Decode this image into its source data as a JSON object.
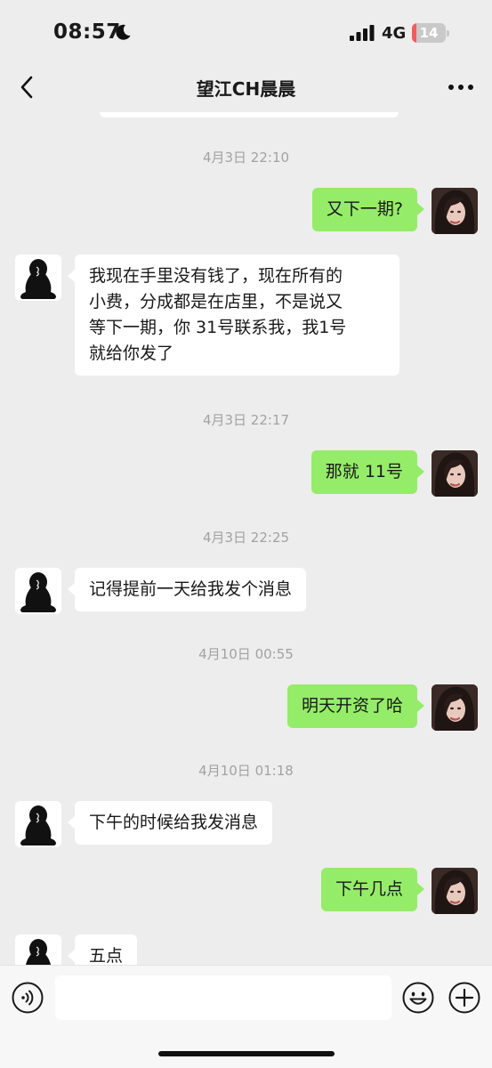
{
  "status_bar": {
    "time": "08:57",
    "network": "4G",
    "battery": "14",
    "battery_level": 0.14,
    "icons": [
      "moon-icon",
      "signal-icon",
      "battery-icon"
    ]
  },
  "nav": {
    "title": "望江CH晨晨",
    "back_icon": "chevron-left-icon",
    "more_icon": "more-dots-icon"
  },
  "messages": [
    {
      "type": "time",
      "text": "4月3日 22:10"
    },
    {
      "type": "msg",
      "from": "self",
      "text": "又下一期?"
    },
    {
      "type": "msg",
      "from": "other",
      "lines": [
        "我现在手里没有钱了，现在所有的",
        "小费，分成都是在店里，不是说又",
        "等下一期，你 31号联系我，我1号",
        "就给你发了"
      ]
    },
    {
      "type": "time",
      "text": "4月3日 22:17"
    },
    {
      "type": "msg",
      "from": "self",
      "text": "那就 11号"
    },
    {
      "type": "time",
      "text": "4月3日 22:25"
    },
    {
      "type": "msg",
      "from": "other",
      "text": "记得提前一天给我发个消息"
    },
    {
      "type": "time",
      "text": "4月10日 00:55"
    },
    {
      "type": "msg",
      "from": "self",
      "text": "明天开资了哈"
    },
    {
      "type": "time",
      "text": "4月10日 01:18"
    },
    {
      "type": "msg",
      "from": "other",
      "text": "下午的时候给我发消息"
    },
    {
      "type": "msg",
      "from": "self",
      "text": "下午几点"
    },
    {
      "type": "msg",
      "from": "other",
      "text": "五点"
    }
  ],
  "input_bar": {
    "placeholder": "",
    "icons": [
      "voice-icon",
      "emoji-icon",
      "plus-icon"
    ]
  },
  "colors": {
    "background": "#ededed",
    "bubble_self": "#95ec69",
    "bubble_other": "#ffffff",
    "timestamp": "#a2a2a2",
    "battery_low": "#f45b5b"
  }
}
